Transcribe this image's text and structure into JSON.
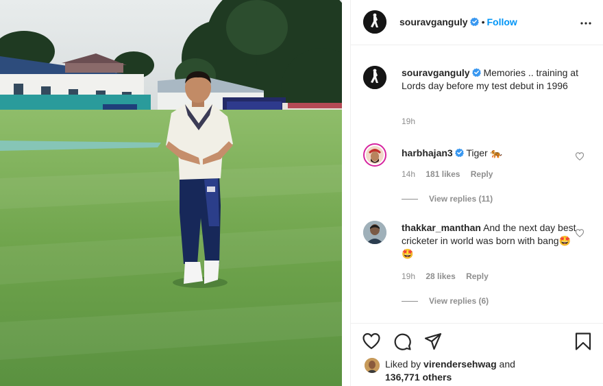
{
  "post": {
    "owner_username": "souravganguly",
    "follow_label": "Follow",
    "dot": "•",
    "caption": "Memories .. training at Lords day before my test debut in 1996",
    "caption_time": "19h"
  },
  "comments": [
    {
      "username": "harbhajan3",
      "text": "Tiger 🐅",
      "time": "14h",
      "likes": "181 likes",
      "reply_label": "Reply",
      "view_replies": "View replies (11)"
    },
    {
      "username": "thakkar_manthan",
      "text": "And the next day best cricketer in world was born with bang🤩🤩",
      "time": "19h",
      "likes": "28 likes",
      "reply_label": "Reply",
      "view_replies": "View replies (6)"
    }
  ],
  "likes_bar": {
    "prefix": "Liked by",
    "liker": "virendersehwag",
    "joiner": "and",
    "others": "136,771 others"
  },
  "icons": {
    "more": "more-options-icon",
    "verified": "verified-badge-icon",
    "like": "heart-icon",
    "comment": "comment-icon",
    "share": "paper-plane-icon",
    "save": "bookmark-icon"
  },
  "colors": {
    "link_blue": "#0095f6",
    "verified_blue": "#3897f0",
    "text": "#262626",
    "muted": "#8e8e8e",
    "border": "#efefef"
  }
}
